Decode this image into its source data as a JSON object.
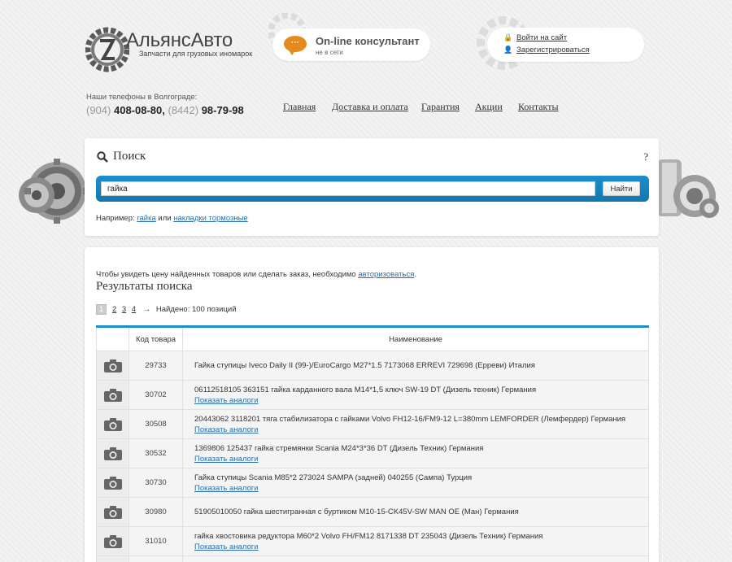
{
  "header": {
    "logo_title": "АльянсАвто",
    "logo_subtitle": "Запчасти для грузовых иномарок",
    "consultant_icon": "chat-bubble-icon",
    "consultant_bubble": "···",
    "consultant_title": "On-line консультант",
    "consultant_status": "не в сети",
    "login_label": "Войти на сайт",
    "register_label": "Зарегистрироваться",
    "phones_label": "Наши телефоны в Волгограде:",
    "phone1_code": "(904)",
    "phone1_number": "408-08-80,",
    "phone2_code": "(8442)",
    "phone2_number": "98-79-98"
  },
  "nav": [
    "Главная",
    "Доставка и оплата",
    "Гарантия",
    "Акции",
    "Контакты"
  ],
  "search": {
    "title": "Поиск",
    "help": "?",
    "value": "гайка",
    "button": "Найти",
    "example_prefix": "Например:",
    "example_link1": "гайка",
    "example_or": "или",
    "example_link2": "накладки тормозные"
  },
  "results": {
    "auth_prefix": "Чтобы увидеть цену найденных товаров или сделать заказ, необходимо",
    "auth_link": "авторизоваться",
    "auth_suffix": ".",
    "title": "Результаты поиска",
    "pages": [
      "1",
      "2",
      "3",
      "4"
    ],
    "arrow": "→",
    "found": "Найдено: 100 позиций",
    "col_code": "Код товара",
    "col_name": "Наименование",
    "rows": [
      {
        "code": "29733",
        "name": "Гайка ступицы Iveco Daily II (99-)/EuroCargo M27*1.5 7173068 ERREVI 729698 (Ерреви) Италия",
        "analog": ""
      },
      {
        "code": "30702",
        "name": "06112518105 363151 гайка карданного вала М14*1,5 ключ SW-19 DT (Дизель техник) Германия",
        "analog": "Показать аналоги"
      },
      {
        "code": "30508",
        "name": "20443062 3118201 тяга стабилизатора с гайками Volvo FH12-16/FM9-12 L=380mm LEMFORDER (Лемфердер) Германия",
        "analog": "Показать аналоги"
      },
      {
        "code": "30532",
        "name": "1369806 125437 гайка стремянки Scania M24*3*36 DT (Дизель Техник) Германия",
        "analog": "Показать аналоги"
      },
      {
        "code": "30730",
        "name": "Гайка ступицы Scania M85*2 273024 SAMPA (задней) 040255 (Сампа) Турция",
        "analog": "Показать аналоги"
      },
      {
        "code": "30980",
        "name": "51905010050 гайка шестигранная с буртиком M10-15-CK45V-SW MAN OE (Ман) Германия",
        "analog": ""
      },
      {
        "code": "31010",
        "name": "гайка хвостовика редуктора M60*2 Volvo FH/FM12 8171338 DT 235043 (Дизель Техник) Германия",
        "analog": "Показать аналоги"
      },
      {
        "code": "",
        "name": "",
        "analog": ""
      }
    ]
  }
}
